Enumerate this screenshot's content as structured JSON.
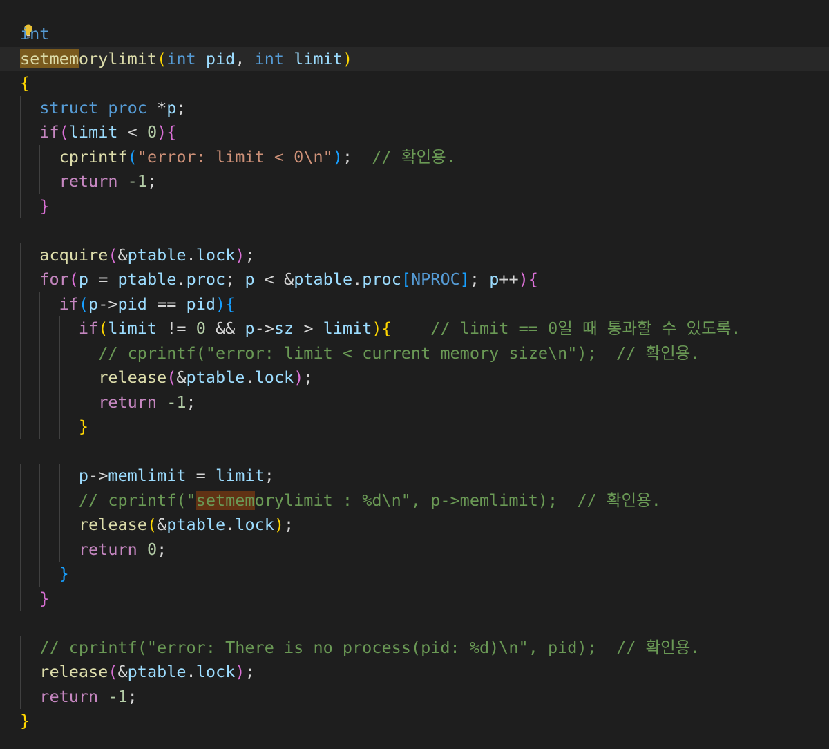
{
  "editor": {
    "colors": {
      "background": "#1e1e1e",
      "keyword": "#c586c0",
      "type": "#569cd6",
      "function": "#dcdcaa",
      "variable": "#9cdcfe",
      "string": "#ce9178",
      "number": "#b5cea8",
      "comment": "#6a9955",
      "constant": "#4fc1ff",
      "word_highlight": "#7a5a1e"
    },
    "lightbulb_icon": "lightbulb-icon",
    "lines": [
      {
        "tokens": [
          {
            "t": "int",
            "c": "ty"
          }
        ]
      },
      {
        "tokens": [
          {
            "t": "setmem",
            "c": "fn hl-word"
          },
          {
            "t": "orylimit",
            "c": "fn"
          },
          {
            "t": "(",
            "c": "b1"
          },
          {
            "t": "int",
            "c": "ty"
          },
          {
            "t": " "
          },
          {
            "t": "pid",
            "c": "var"
          },
          {
            "t": ", "
          },
          {
            "t": "int",
            "c": "ty"
          },
          {
            "t": " "
          },
          {
            "t": "limit",
            "c": "var"
          },
          {
            "t": ")",
            "c": "b1"
          }
        ]
      },
      {
        "tokens": [
          {
            "t": "{",
            "c": "b1"
          }
        ]
      },
      {
        "tokens": [
          {
            "t": "  "
          },
          {
            "t": "struct",
            "c": "ty"
          },
          {
            "t": " "
          },
          {
            "t": "proc",
            "c": "ty"
          },
          {
            "t": " *"
          },
          {
            "t": "p",
            "c": "var"
          },
          {
            "t": ";"
          }
        ]
      },
      {
        "tokens": [
          {
            "t": "  "
          },
          {
            "t": "if",
            "c": "kw"
          },
          {
            "t": "(",
            "c": "b2"
          },
          {
            "t": "limit",
            "c": "var"
          },
          {
            "t": " < "
          },
          {
            "t": "0",
            "c": "num"
          },
          {
            "t": ")",
            "c": "b2"
          },
          {
            "t": "{",
            "c": "b2"
          }
        ]
      },
      {
        "tokens": [
          {
            "t": "    "
          },
          {
            "t": "cprintf",
            "c": "fn"
          },
          {
            "t": "(",
            "c": "b3"
          },
          {
            "t": "\"error: limit < 0\\n\"",
            "c": "str"
          },
          {
            "t": ")",
            "c": "b3"
          },
          {
            "t": ";  "
          },
          {
            "t": "// 확인용.",
            "c": "cmt"
          }
        ]
      },
      {
        "tokens": [
          {
            "t": "    "
          },
          {
            "t": "return",
            "c": "kw"
          },
          {
            "t": " "
          },
          {
            "t": "-1",
            "c": "num"
          },
          {
            "t": ";"
          }
        ]
      },
      {
        "tokens": [
          {
            "t": "  "
          },
          {
            "t": "}",
            "c": "b2"
          }
        ]
      },
      {
        "tokens": []
      },
      {
        "tokens": [
          {
            "t": "  "
          },
          {
            "t": "acquire",
            "c": "fn"
          },
          {
            "t": "(",
            "c": "b2"
          },
          {
            "t": "&"
          },
          {
            "t": "ptable",
            "c": "var"
          },
          {
            "t": "."
          },
          {
            "t": "lock",
            "c": "var"
          },
          {
            "t": ")",
            "c": "b2"
          },
          {
            "t": ";"
          }
        ]
      },
      {
        "tokens": [
          {
            "t": "  "
          },
          {
            "t": "for",
            "c": "kw"
          },
          {
            "t": "(",
            "c": "b2"
          },
          {
            "t": "p",
            "c": "var"
          },
          {
            "t": " = "
          },
          {
            "t": "ptable",
            "c": "var"
          },
          {
            "t": "."
          },
          {
            "t": "proc",
            "c": "var"
          },
          {
            "t": "; "
          },
          {
            "t": "p",
            "c": "var"
          },
          {
            "t": " < &"
          },
          {
            "t": "ptable",
            "c": "var"
          },
          {
            "t": "."
          },
          {
            "t": "proc",
            "c": "var"
          },
          {
            "t": "[",
            "c": "b3"
          },
          {
            "t": "NPROC",
            "c": "ty"
          },
          {
            "t": "]",
            "c": "b3"
          },
          {
            "t": "; "
          },
          {
            "t": "p",
            "c": "var"
          },
          {
            "t": "++"
          },
          {
            "t": ")",
            "c": "b2"
          },
          {
            "t": "{",
            "c": "b2"
          }
        ]
      },
      {
        "tokens": [
          {
            "t": "    "
          },
          {
            "t": "if",
            "c": "kw"
          },
          {
            "t": "(",
            "c": "b3"
          },
          {
            "t": "p",
            "c": "var"
          },
          {
            "t": "->"
          },
          {
            "t": "pid",
            "c": "var"
          },
          {
            "t": " == "
          },
          {
            "t": "pid",
            "c": "var"
          },
          {
            "t": ")",
            "c": "b3"
          },
          {
            "t": "{",
            "c": "b3"
          }
        ]
      },
      {
        "tokens": [
          {
            "t": "      "
          },
          {
            "t": "if",
            "c": "kw"
          },
          {
            "t": "(",
            "c": "b1"
          },
          {
            "t": "limit",
            "c": "var"
          },
          {
            "t": " != "
          },
          {
            "t": "0",
            "c": "num"
          },
          {
            "t": " && "
          },
          {
            "t": "p",
            "c": "var"
          },
          {
            "t": "->"
          },
          {
            "t": "sz",
            "c": "var"
          },
          {
            "t": " > "
          },
          {
            "t": "limit",
            "c": "var"
          },
          {
            "t": ")",
            "c": "b1"
          },
          {
            "t": "{",
            "c": "b1"
          },
          {
            "t": "    "
          },
          {
            "t": "// limit == 0일 때 통과할 수 있도록.",
            "c": "cmt"
          }
        ]
      },
      {
        "tokens": [
          {
            "t": "        "
          },
          {
            "t": "// cprintf(\"error: limit < current memory size\\n\");  // 확인용.",
            "c": "cmt"
          }
        ]
      },
      {
        "tokens": [
          {
            "t": "        "
          },
          {
            "t": "release",
            "c": "fn"
          },
          {
            "t": "(",
            "c": "b2"
          },
          {
            "t": "&"
          },
          {
            "t": "ptable",
            "c": "var"
          },
          {
            "t": "."
          },
          {
            "t": "lock",
            "c": "var"
          },
          {
            "t": ")",
            "c": "b2"
          },
          {
            "t": ";"
          }
        ]
      },
      {
        "tokens": [
          {
            "t": "        "
          },
          {
            "t": "return",
            "c": "kw"
          },
          {
            "t": " "
          },
          {
            "t": "-1",
            "c": "num"
          },
          {
            "t": ";"
          }
        ]
      },
      {
        "tokens": [
          {
            "t": "      "
          },
          {
            "t": "}",
            "c": "b1"
          }
        ]
      },
      {
        "tokens": []
      },
      {
        "tokens": [
          {
            "t": "      "
          },
          {
            "t": "p",
            "c": "var"
          },
          {
            "t": "->"
          },
          {
            "t": "memlimit",
            "c": "var"
          },
          {
            "t": " = "
          },
          {
            "t": "limit",
            "c": "var"
          },
          {
            "t": ";"
          }
        ]
      },
      {
        "tokens": [
          {
            "t": "      "
          },
          {
            "t": "// cprintf(\"",
            "c": "cmt"
          },
          {
            "t": "setmem",
            "c": "cmt hl-match"
          },
          {
            "t": "orylimit : %d\\n\", p->memlimit);  // 확인용.",
            "c": "cmt"
          }
        ]
      },
      {
        "tokens": [
          {
            "t": "      "
          },
          {
            "t": "release",
            "c": "fn"
          },
          {
            "t": "(",
            "c": "b1"
          },
          {
            "t": "&"
          },
          {
            "t": "ptable",
            "c": "var"
          },
          {
            "t": "."
          },
          {
            "t": "lock",
            "c": "var"
          },
          {
            "t": ")",
            "c": "b1"
          },
          {
            "t": ";"
          }
        ]
      },
      {
        "tokens": [
          {
            "t": "      "
          },
          {
            "t": "return",
            "c": "kw"
          },
          {
            "t": " "
          },
          {
            "t": "0",
            "c": "num"
          },
          {
            "t": ";"
          }
        ]
      },
      {
        "tokens": [
          {
            "t": "    "
          },
          {
            "t": "}",
            "c": "b3"
          }
        ]
      },
      {
        "tokens": [
          {
            "t": "  "
          },
          {
            "t": "}",
            "c": "b2"
          }
        ]
      },
      {
        "tokens": []
      },
      {
        "tokens": [
          {
            "t": "  "
          },
          {
            "t": "// cprintf(\"error: There is no process(pid: %d)\\n\", pid);  // 확인용.",
            "c": "cmt"
          }
        ]
      },
      {
        "tokens": [
          {
            "t": "  "
          },
          {
            "t": "release",
            "c": "fn"
          },
          {
            "t": "(",
            "c": "b2"
          },
          {
            "t": "&"
          },
          {
            "t": "ptable",
            "c": "var"
          },
          {
            "t": "."
          },
          {
            "t": "lock",
            "c": "var"
          },
          {
            "t": ")",
            "c": "b2"
          },
          {
            "t": ";"
          }
        ]
      },
      {
        "tokens": [
          {
            "t": "  "
          },
          {
            "t": "return",
            "c": "kw"
          },
          {
            "t": " "
          },
          {
            "t": "-1",
            "c": "num"
          },
          {
            "t": ";"
          }
        ]
      },
      {
        "tokens": [
          {
            "t": "}",
            "c": "b1"
          }
        ]
      }
    ]
  }
}
